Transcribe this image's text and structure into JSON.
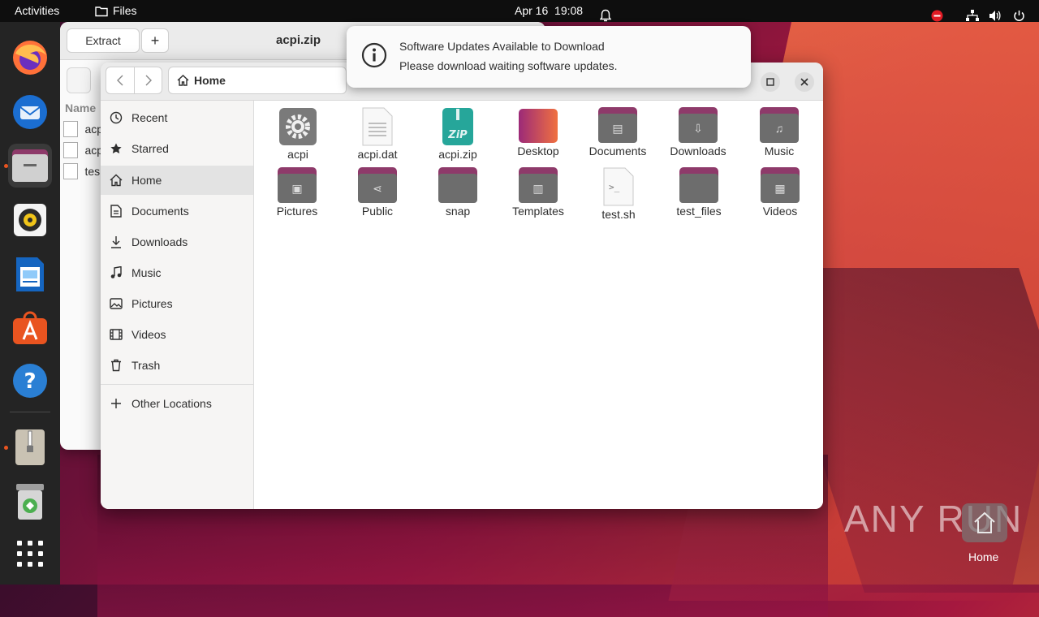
{
  "topbar": {
    "activities": "Activities",
    "app_name": "Files",
    "date": "Apr 16",
    "time": "19:08"
  },
  "archive_window": {
    "extract_label": "Extract",
    "add_label": "+",
    "title": "acpi.zip",
    "column_name": "Name",
    "rows": [
      "acp",
      "acp",
      "tes"
    ]
  },
  "notification": {
    "title": "Software Updates Available to Download",
    "body": "Please download waiting software updates."
  },
  "files_window": {
    "location": "Home",
    "sidebar": [
      {
        "label": "Recent",
        "icon": "clock-icon"
      },
      {
        "label": "Starred",
        "icon": "star-icon"
      },
      {
        "label": "Home",
        "icon": "home-icon"
      },
      {
        "label": "Documents",
        "icon": "document-icon"
      },
      {
        "label": "Downloads",
        "icon": "download-icon"
      },
      {
        "label": "Music",
        "icon": "music-icon"
      },
      {
        "label": "Pictures",
        "icon": "picture-icon"
      },
      {
        "label": "Videos",
        "icon": "video-icon"
      },
      {
        "label": "Trash",
        "icon": "trash-icon"
      },
      {
        "label": "Other Locations",
        "icon": "plus-icon"
      }
    ],
    "files": [
      {
        "name": "acpi",
        "type": "executable"
      },
      {
        "name": "acpi.dat",
        "type": "text"
      },
      {
        "name": "acpi.zip",
        "type": "zip"
      },
      {
        "name": "Desktop",
        "type": "folder-desktop"
      },
      {
        "name": "Documents",
        "type": "folder"
      },
      {
        "name": "Downloads",
        "type": "folder"
      },
      {
        "name": "Music",
        "type": "folder"
      },
      {
        "name": "Pictures",
        "type": "folder"
      },
      {
        "name": "Public",
        "type": "folder"
      },
      {
        "name": "snap",
        "type": "folder"
      },
      {
        "name": "Templates",
        "type": "folder"
      },
      {
        "name": "test.sh",
        "type": "script"
      },
      {
        "name": "test_files",
        "type": "folder"
      },
      {
        "name": "Videos",
        "type": "folder"
      }
    ]
  },
  "desktop": {
    "home_label": "Home",
    "watermark": "ANY RUN"
  },
  "colors": {
    "accent": "#e95420",
    "folder_tab": "#8e3a6a",
    "folder_body": "#6d6d6d",
    "selected_row": "#e3e3e3"
  }
}
